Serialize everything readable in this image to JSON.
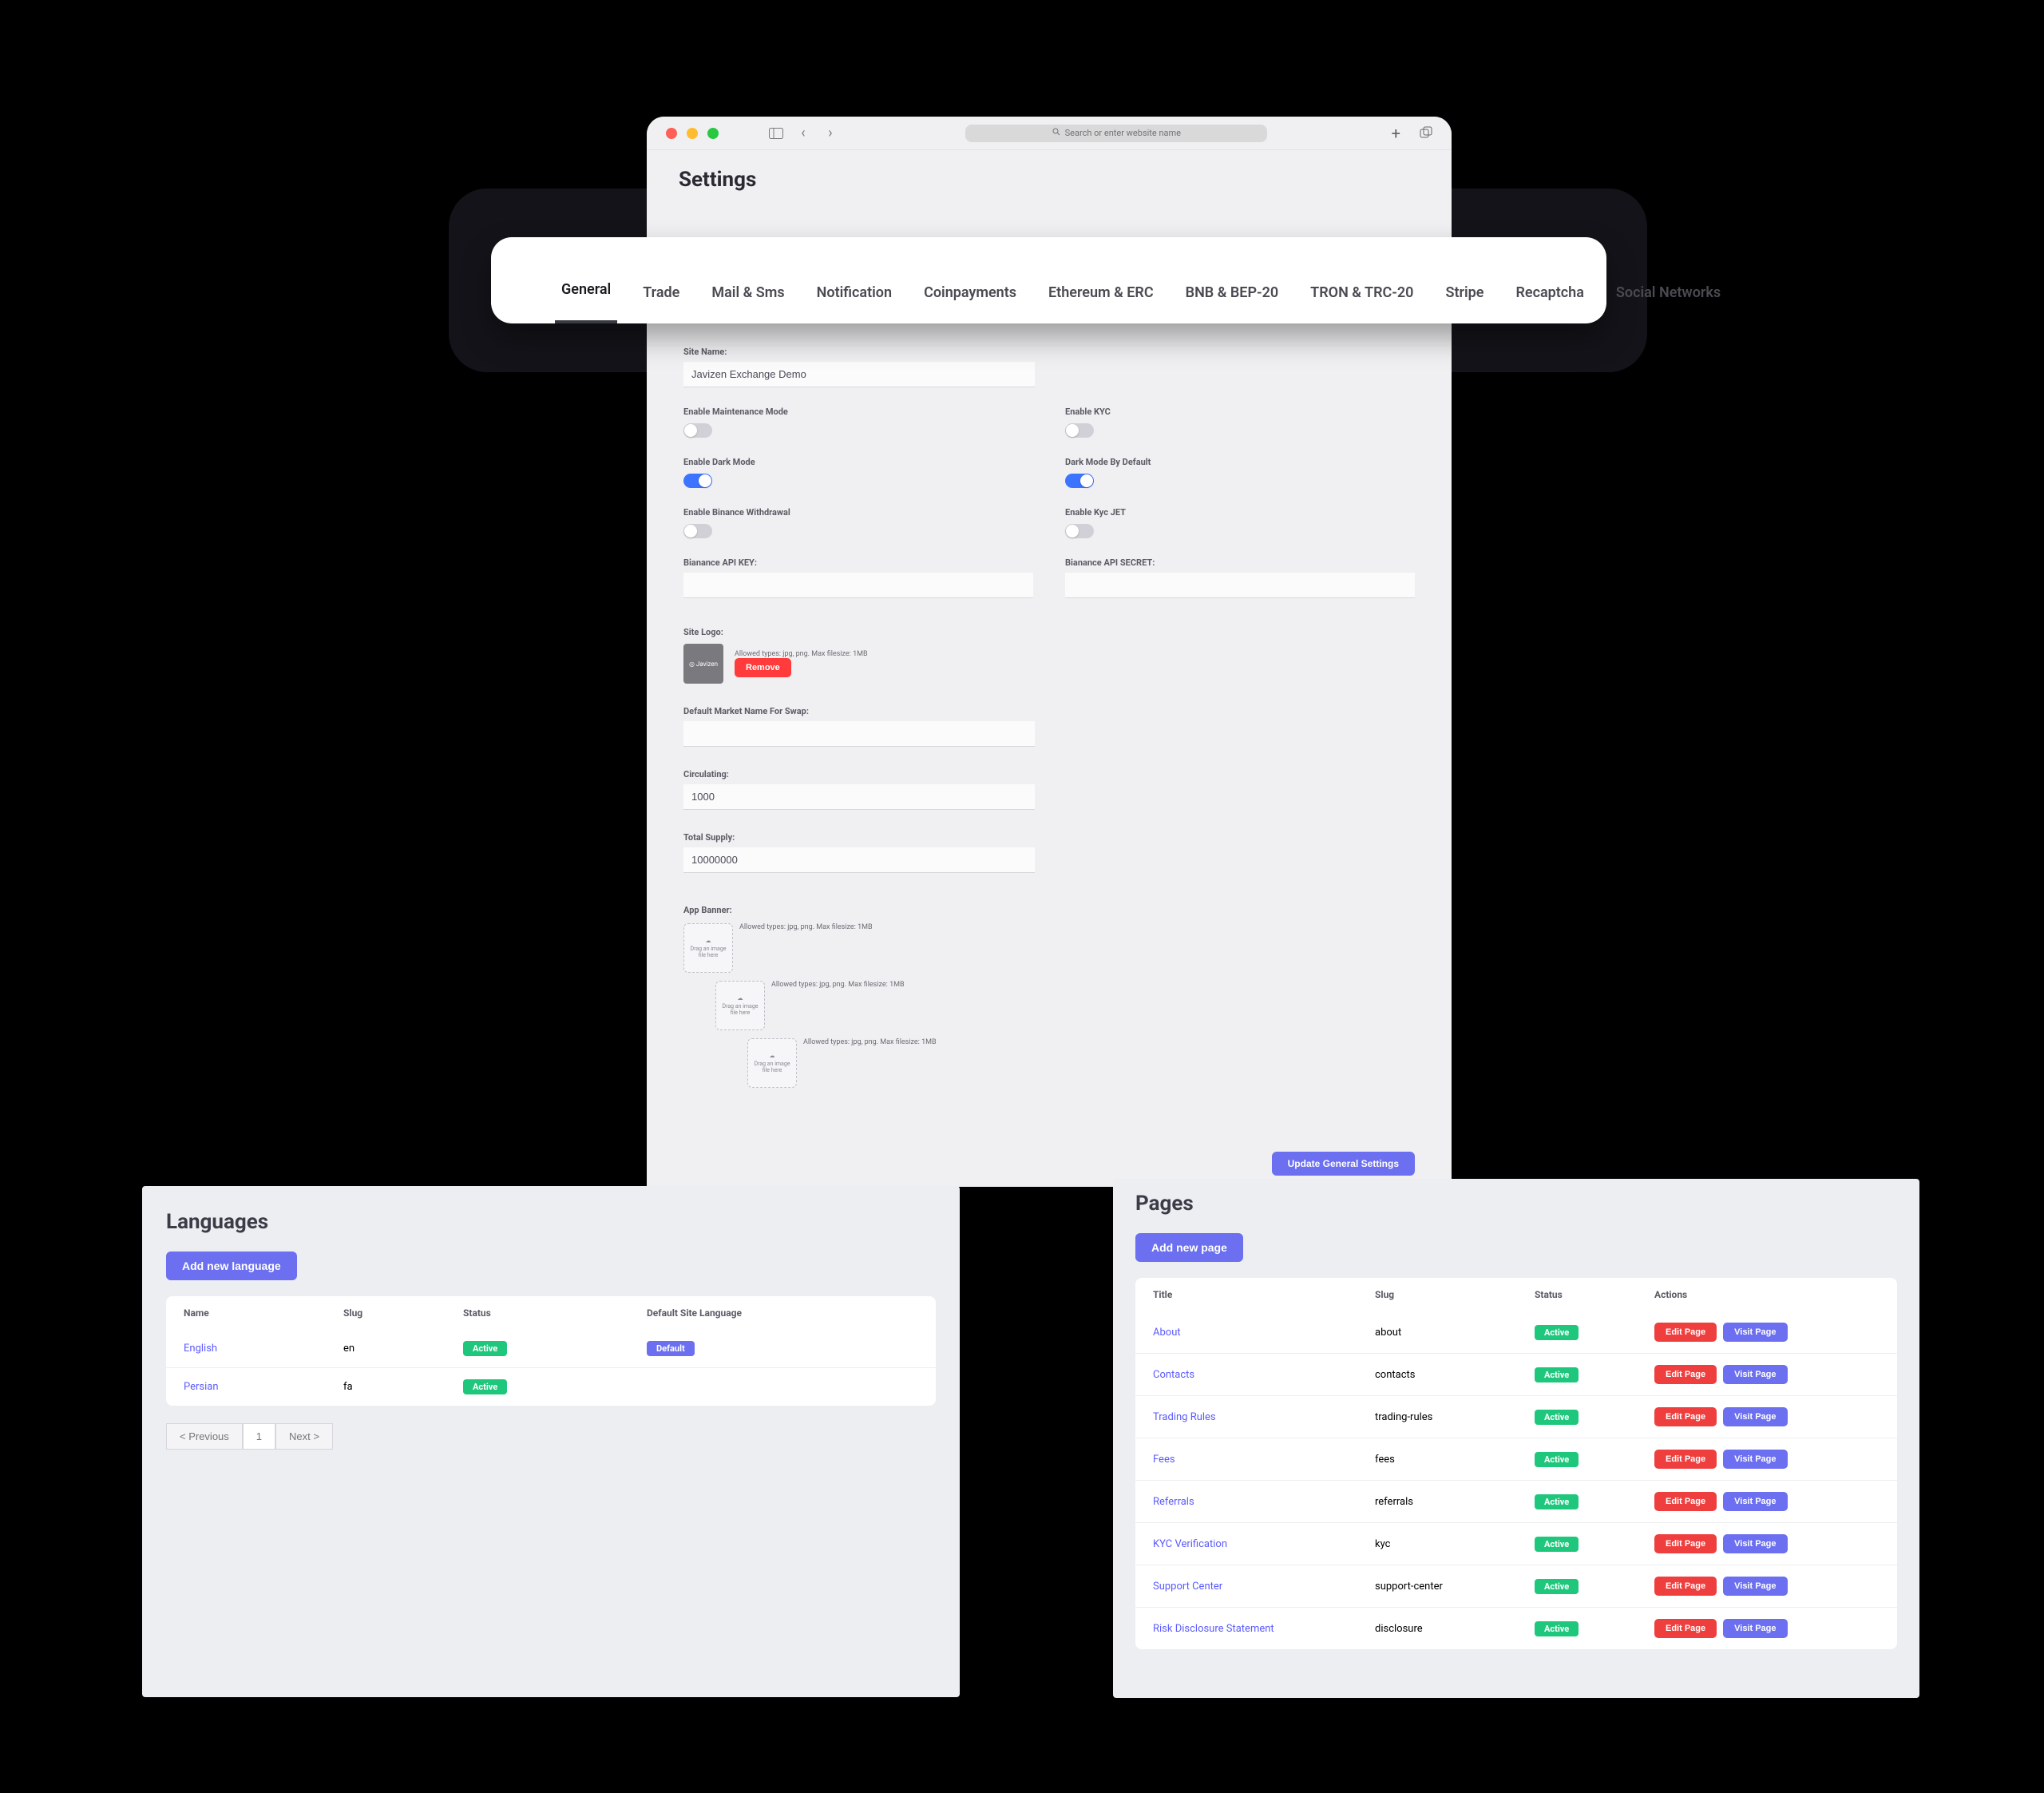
{
  "browser": {
    "placeholder": "Search or enter website name"
  },
  "settings": {
    "title": "Settings",
    "tabs": [
      "General",
      "Trade",
      "Mail & Sms",
      "Notification",
      "Coinpayments",
      "Ethereum & ERC",
      "BNB & BEP-20",
      "TRON & TRC-20",
      "Stripe",
      "Recaptcha",
      "Social Networks"
    ],
    "fields": {
      "site_name_label": "Site Name:",
      "site_name_value": "Javizen Exchange Demo",
      "enable_maintenance_label": "Enable Maintenance Mode",
      "enable_kyc_label": "Enable KYC",
      "enable_dark_label": "Enable Dark Mode",
      "dark_default_label": "Dark Mode By Default",
      "enable_binance_withdrawal_label": "Enable Binance Withdrawal",
      "enable_kyc_jet_label": "Enable Kyc JET",
      "binance_key_label": "Bianance API KEY:",
      "binance_secret_label": "Bianance API SECRET:",
      "site_logo_label": "Site Logo:",
      "allowed_hint": "Allowed types: jpg, png. Max filesize: 1MB",
      "remove_label": "Remove",
      "default_market_label": "Default Market Name For Swap:",
      "circulating_label": "Circulating:",
      "circulating_value": "1000",
      "total_supply_label": "Total Supply:",
      "total_supply_value": "10000000",
      "app_banner_label": "App Banner:",
      "dropzone_text": "Drag an image file here",
      "update_button": "Update General Settings"
    }
  },
  "languages": {
    "title": "Languages",
    "add_button": "Add new language",
    "headers": {
      "name": "Name",
      "slug": "Slug",
      "status": "Status",
      "default": "Default Site Language"
    },
    "status_active": "Active",
    "default_badge": "Default",
    "rows": [
      {
        "name": "English",
        "slug": "en",
        "status": "Active",
        "default": true
      },
      {
        "name": "Persian",
        "slug": "fa",
        "status": "Active",
        "default": false
      }
    ],
    "pager": {
      "prev": "< Previous",
      "p1": "1",
      "next": "Next >"
    }
  },
  "pages": {
    "title": "Pages",
    "add_button": "Add new page",
    "headers": {
      "title": "Title",
      "slug": "Slug",
      "status": "Status",
      "actions": "Actions"
    },
    "status_active": "Active",
    "edit_label": "Edit Page",
    "visit_label": "Visit Page",
    "rows": [
      {
        "title": "About",
        "slug": "about"
      },
      {
        "title": "Contacts",
        "slug": "contacts"
      },
      {
        "title": "Trading Rules",
        "slug": "trading-rules"
      },
      {
        "title": "Fees",
        "slug": "fees"
      },
      {
        "title": "Referrals",
        "slug": "referrals"
      },
      {
        "title": "KYC Verification",
        "slug": "kyc"
      },
      {
        "title": "Support Center",
        "slug": "support-center"
      },
      {
        "title": "Risk Disclosure Statement",
        "slug": "disclosure"
      }
    ]
  }
}
